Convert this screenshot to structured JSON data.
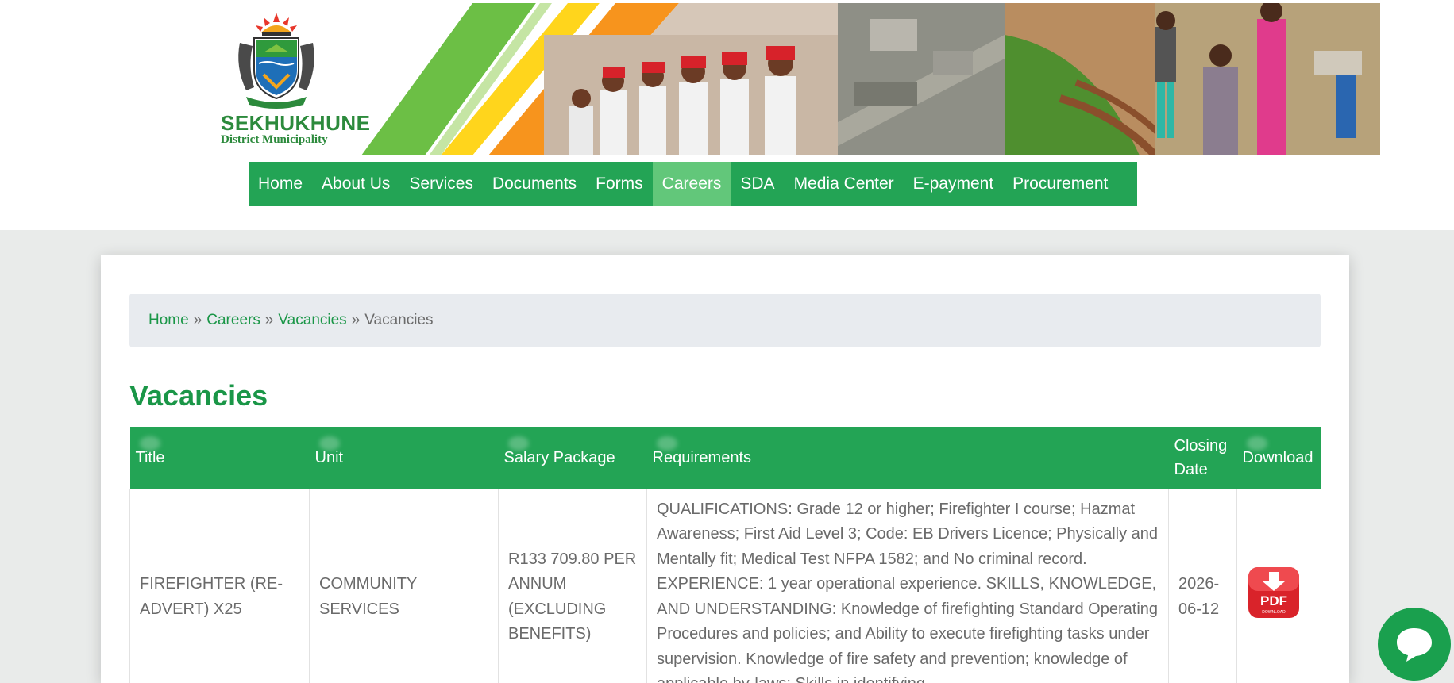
{
  "logo": {
    "name": "SEKHUKHUNE",
    "subtitle": "District Municipality"
  },
  "nav": {
    "items": [
      {
        "label": "Home",
        "active": false
      },
      {
        "label": "About Us",
        "active": false
      },
      {
        "label": "Services",
        "active": false
      },
      {
        "label": "Documents",
        "active": false
      },
      {
        "label": "Forms",
        "active": false
      },
      {
        "label": "Careers",
        "active": true
      },
      {
        "label": "SDA",
        "active": false
      },
      {
        "label": "Media Center",
        "active": false
      },
      {
        "label": "E-payment",
        "active": false
      },
      {
        "label": "Procurement",
        "active": false
      }
    ]
  },
  "breadcrumb": {
    "home": "Home",
    "careers": "Careers",
    "vacancies_link": "Vacancies",
    "current": "Vacancies",
    "separator": "»"
  },
  "page": {
    "title": "Vacancies"
  },
  "table": {
    "headers": {
      "title": "Title",
      "unit": "Unit",
      "salary": "Salary Package",
      "requirements": "Requirements",
      "closing_date": "Closing Date",
      "download": "Download"
    },
    "rows": [
      {
        "title": "FIREFIGHTER (RE-ADVERT) X25",
        "unit": "COMMUNITY SERVICES",
        "salary": "R133 709.80 PER ANNUM (EXCLUDING BENEFITS)",
        "requirements": "QUALIFICATIONS: Grade 12 or higher; Firefighter I course; Hazmat Awareness; First Aid Level 3; Code: EB Drivers Licence; Physically and Mentally fit; Medical Test NFPA 1582; and No criminal record. EXPERIENCE: 1 year operational experience. SKILLS, KNOWLEDGE, AND UNDERSTANDING: Knowledge of firefighting Standard Operating Procedures and policies; and Ability to execute firefighting tasks under supervision. Knowledge of fire safety and prevention; knowledge of applicable by-laws; Skills in identifying",
        "closing_date": "2026-06-12",
        "download_icon": "pdf-download-icon"
      }
    ]
  },
  "icons": {
    "pdf_text": "PDF",
    "pdf_sub": "DOWNLOAD",
    "chat": "chat-bubble-icon"
  },
  "colors": {
    "brand_green": "#23a455",
    "nav_active": "#62c77a",
    "link_green": "#1a9647",
    "pdf_red": "#d9232a"
  }
}
